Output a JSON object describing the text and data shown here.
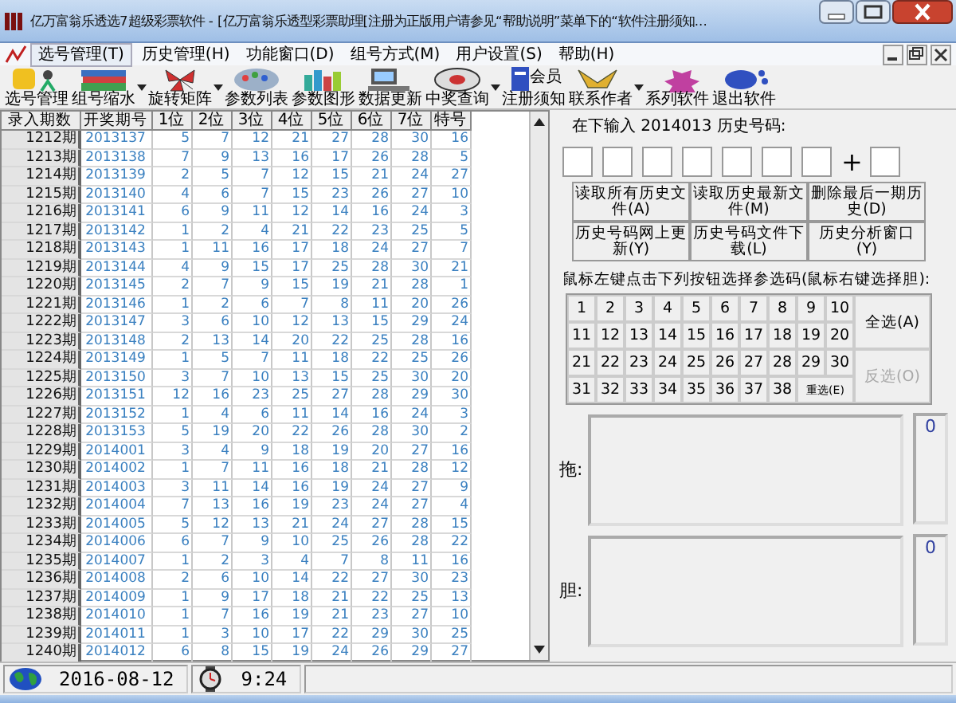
{
  "window": {
    "title": "亿万富翁乐透选7超级彩票软件 - [亿万富翁乐透型彩票助理[注册为正版用户请参见“帮助说明”菜单下的“软件注册须知..."
  },
  "menu": [
    {
      "label": "选号管理(T)",
      "selected": true
    },
    {
      "label": "历史管理(H)",
      "selected": false
    },
    {
      "label": "功能窗口(D)",
      "selected": false
    },
    {
      "label": "组号方式(M)",
      "selected": false
    },
    {
      "label": "用户设置(S)",
      "selected": false
    },
    {
      "label": "帮助(H)",
      "selected": false
    }
  ],
  "toolbar": [
    {
      "label": "选号管理",
      "dropdown": false
    },
    {
      "label": "组号缩水",
      "dropdown": true
    },
    {
      "label": "旋转矩阵",
      "dropdown": true
    },
    {
      "label": "参数列表",
      "dropdown": false
    },
    {
      "label": "参数图形",
      "dropdown": false
    },
    {
      "label": "数据更新",
      "dropdown": false
    },
    {
      "label": "中奖查询",
      "dropdown": true
    },
    {
      "label": "注册须知",
      "dropdown": false,
      "badge": "会员"
    },
    {
      "label": "联系作者",
      "dropdown": true
    },
    {
      "label": "系列软件",
      "dropdown": false
    },
    {
      "label": "退出软件",
      "dropdown": false
    }
  ],
  "table": {
    "columns": [
      "录入期数",
      "开奖期号",
      "1位",
      "2位",
      "3位",
      "4位",
      "5位",
      "6位",
      "7位",
      "特号"
    ],
    "rows": [
      [
        "1212期",
        "2013137",
        "5",
        "7",
        "12",
        "21",
        "27",
        "28",
        "30",
        "16"
      ],
      [
        "1213期",
        "2013138",
        "7",
        "9",
        "13",
        "16",
        "17",
        "26",
        "28",
        "5"
      ],
      [
        "1214期",
        "2013139",
        "2",
        "5",
        "7",
        "12",
        "15",
        "21",
        "24",
        "27"
      ],
      [
        "1215期",
        "2013140",
        "4",
        "6",
        "7",
        "15",
        "23",
        "26",
        "27",
        "10"
      ],
      [
        "1216期",
        "2013141",
        "6",
        "9",
        "11",
        "12",
        "14",
        "16",
        "24",
        "3"
      ],
      [
        "1217期",
        "2013142",
        "1",
        "2",
        "4",
        "21",
        "22",
        "23",
        "25",
        "5"
      ],
      [
        "1218期",
        "2013143",
        "1",
        "11",
        "16",
        "17",
        "18",
        "24",
        "27",
        "7"
      ],
      [
        "1219期",
        "2013144",
        "4",
        "9",
        "15",
        "17",
        "25",
        "28",
        "30",
        "21"
      ],
      [
        "1220期",
        "2013145",
        "2",
        "7",
        "9",
        "15",
        "19",
        "21",
        "28",
        "1"
      ],
      [
        "1221期",
        "2013146",
        "1",
        "2",
        "6",
        "7",
        "8",
        "11",
        "20",
        "26"
      ],
      [
        "1222期",
        "2013147",
        "3",
        "6",
        "10",
        "12",
        "13",
        "15",
        "29",
        "24"
      ],
      [
        "1223期",
        "2013148",
        "2",
        "13",
        "14",
        "20",
        "22",
        "25",
        "28",
        "16"
      ],
      [
        "1224期",
        "2013149",
        "1",
        "5",
        "7",
        "11",
        "18",
        "22",
        "25",
        "26"
      ],
      [
        "1225期",
        "2013150",
        "3",
        "7",
        "10",
        "13",
        "15",
        "25",
        "30",
        "20"
      ],
      [
        "1226期",
        "2013151",
        "12",
        "16",
        "23",
        "25",
        "27",
        "28",
        "29",
        "30"
      ],
      [
        "1227期",
        "2013152",
        "1",
        "4",
        "6",
        "11",
        "14",
        "16",
        "24",
        "3"
      ],
      [
        "1228期",
        "2013153",
        "5",
        "19",
        "20",
        "22",
        "26",
        "28",
        "30",
        "2"
      ],
      [
        "1229期",
        "2014001",
        "3",
        "4",
        "9",
        "18",
        "19",
        "20",
        "27",
        "16"
      ],
      [
        "1230期",
        "2014002",
        "1",
        "7",
        "11",
        "16",
        "18",
        "21",
        "28",
        "12"
      ],
      [
        "1231期",
        "2014003",
        "3",
        "11",
        "14",
        "16",
        "19",
        "24",
        "27",
        "9"
      ],
      [
        "1232期",
        "2014004",
        "7",
        "13",
        "16",
        "19",
        "23",
        "24",
        "27",
        "4"
      ],
      [
        "1233期",
        "2014005",
        "5",
        "12",
        "13",
        "21",
        "24",
        "27",
        "28",
        "15"
      ],
      [
        "1234期",
        "2014006",
        "6",
        "7",
        "9",
        "10",
        "25",
        "26",
        "28",
        "22"
      ],
      [
        "1235期",
        "2014007",
        "1",
        "2",
        "3",
        "4",
        "7",
        "8",
        "11",
        "16"
      ],
      [
        "1236期",
        "2014008",
        "2",
        "6",
        "10",
        "14",
        "22",
        "27",
        "30",
        "23"
      ],
      [
        "1237期",
        "2014009",
        "1",
        "9",
        "17",
        "18",
        "21",
        "22",
        "25",
        "13"
      ],
      [
        "1238期",
        "2014010",
        "1",
        "7",
        "16",
        "19",
        "21",
        "23",
        "27",
        "10"
      ],
      [
        "1239期",
        "2014011",
        "1",
        "3",
        "10",
        "17",
        "22",
        "29",
        "30",
        "25"
      ],
      [
        "1240期",
        "2014012",
        "6",
        "8",
        "15",
        "19",
        "24",
        "26",
        "29",
        "27"
      ]
    ]
  },
  "history_input": {
    "prompt": "在下输入 2014013 历史号码:",
    "plus": "+"
  },
  "history_buttons": [
    "读取所有历史文件(A)",
    "读取历史最新文件(M)",
    "删除最后一期历史(D)",
    "历史号码网上更新(Y)",
    "历史号码文件下载(L)",
    "历史分析窗口(Y)"
  ],
  "picker": {
    "hint": "鼠标左键点击下列按钮选择参选码(鼠标右键选择胆):",
    "numbers": [
      "1",
      "2",
      "3",
      "4",
      "5",
      "6",
      "7",
      "8",
      "9",
      "10",
      "11",
      "12",
      "13",
      "14",
      "15",
      "16",
      "17",
      "18",
      "19",
      "20",
      "21",
      "22",
      "23",
      "24",
      "25",
      "26",
      "27",
      "28",
      "29",
      "30",
      "31",
      "32",
      "33",
      "34",
      "35",
      "36",
      "37",
      "38"
    ],
    "reset": "重选(E)",
    "actions": [
      {
        "label": "全选(A)",
        "disabled": false
      },
      {
        "label": "反选(O)",
        "disabled": true
      }
    ]
  },
  "groups": [
    {
      "label": "拖:",
      "count": "0"
    },
    {
      "label": "胆:",
      "count": "0"
    }
  ],
  "status_bar": {
    "date": "2016-08-12",
    "time": "9:24"
  }
}
